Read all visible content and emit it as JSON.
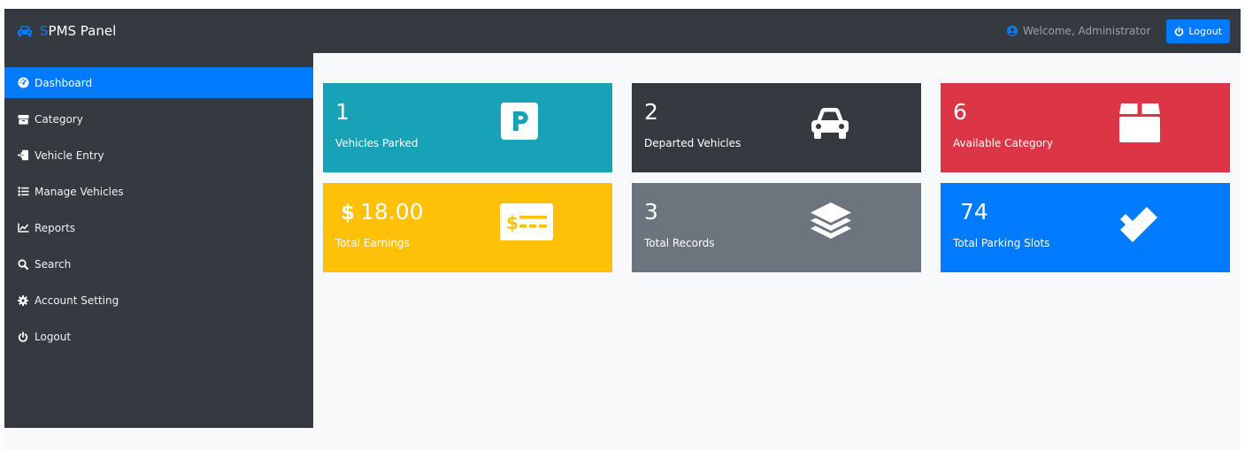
{
  "header": {
    "brand_first": "S",
    "brand_rest": "PMS Panel",
    "welcome": "Welcome, Administrator",
    "logout_label": "Logout"
  },
  "sidebar": {
    "items": [
      {
        "label": "Dashboard",
        "icon": "dashboard-icon",
        "active": true
      },
      {
        "label": "Category",
        "icon": "category-icon"
      },
      {
        "label": "Vehicle Entry",
        "icon": "vehicle-entry-icon"
      },
      {
        "label": "Manage Vehicles",
        "icon": "manage-list-icon"
      },
      {
        "label": "Reports",
        "icon": "chart-icon"
      },
      {
        "label": "Search",
        "icon": "search-icon"
      },
      {
        "label": "Account Setting",
        "icon": "gear-icon"
      },
      {
        "label": "Logout",
        "icon": "power-icon"
      }
    ]
  },
  "cards": [
    {
      "value": "1",
      "label": "Vehicles Parked",
      "color": "#17a2b8",
      "icon": "parking-icon"
    },
    {
      "value": "2",
      "label": "Departed Vehicles",
      "color": "#343a40",
      "icon": "car-icon"
    },
    {
      "value": "6",
      "label": "Available Category",
      "color": "#dc3545",
      "icon": "box-icon"
    },
    {
      "currency": "$",
      "value": "18.00",
      "label": "Total Earnings",
      "color": "#ffc107",
      "icon": "money-check-icon"
    },
    {
      "value": "3",
      "label": "Total Records",
      "color": "#6c757d",
      "icon": "layers-icon"
    },
    {
      "value": "74",
      "label": "Total Parking Slots",
      "color": "#007bff",
      "icon": "double-check-icon"
    }
  ],
  "colors": {
    "accent": "#007bff",
    "dark": "#343a40",
    "background": "#f8f9fa"
  }
}
